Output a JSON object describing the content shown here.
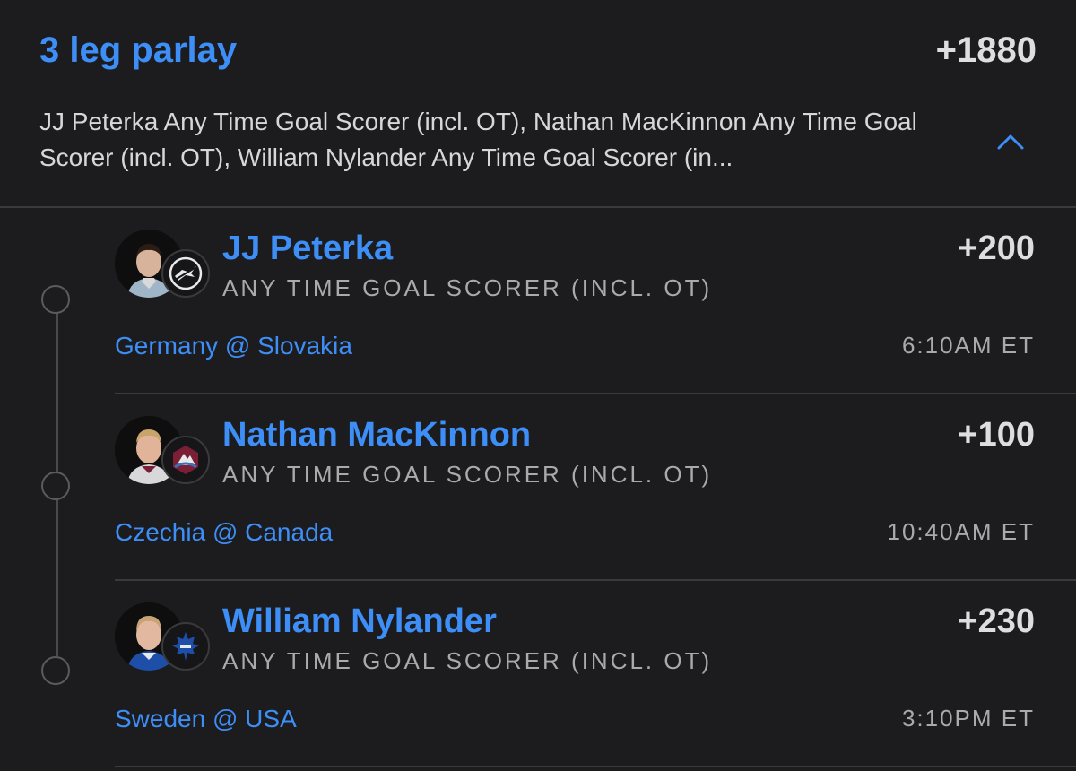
{
  "parlay": {
    "title": "3 leg parlay",
    "odds": "+1880",
    "description": "JJ Peterka Any Time Goal Scorer (incl. OT), Nathan MacKinnon Any Time Goal Scorer (incl. OT), William Nylander Any Time Goal Scorer (in...",
    "collapse_icon": "chevron-up-icon"
  },
  "legs": [
    {
      "player": "JJ Peterka",
      "odds": "+200",
      "market": "ANY TIME GOAL SCORER (INCL. OT)",
      "matchup": "Germany @ Slovakia",
      "time": "6:10AM ET",
      "team_logo_icon": "sabres-logo-icon"
    },
    {
      "player": "Nathan MacKinnon",
      "odds": "+100",
      "market": "ANY TIME GOAL SCORER (INCL. OT)",
      "matchup": "Czechia @ Canada",
      "time": "10:40AM ET",
      "team_logo_icon": "avalanche-logo-icon"
    },
    {
      "player": "William Nylander",
      "odds": "+230",
      "market": "ANY TIME GOAL SCORER (INCL. OT)",
      "matchup": "Sweden @ USA",
      "time": "3:10PM ET",
      "team_logo_icon": "maple-leafs-logo-icon"
    }
  ],
  "colors": {
    "background": "#1c1c1e",
    "accent": "#3d8ef7",
    "text_primary": "#dedee2",
    "text_secondary": "#a9a9ae",
    "divider": "#3a3a3d"
  }
}
